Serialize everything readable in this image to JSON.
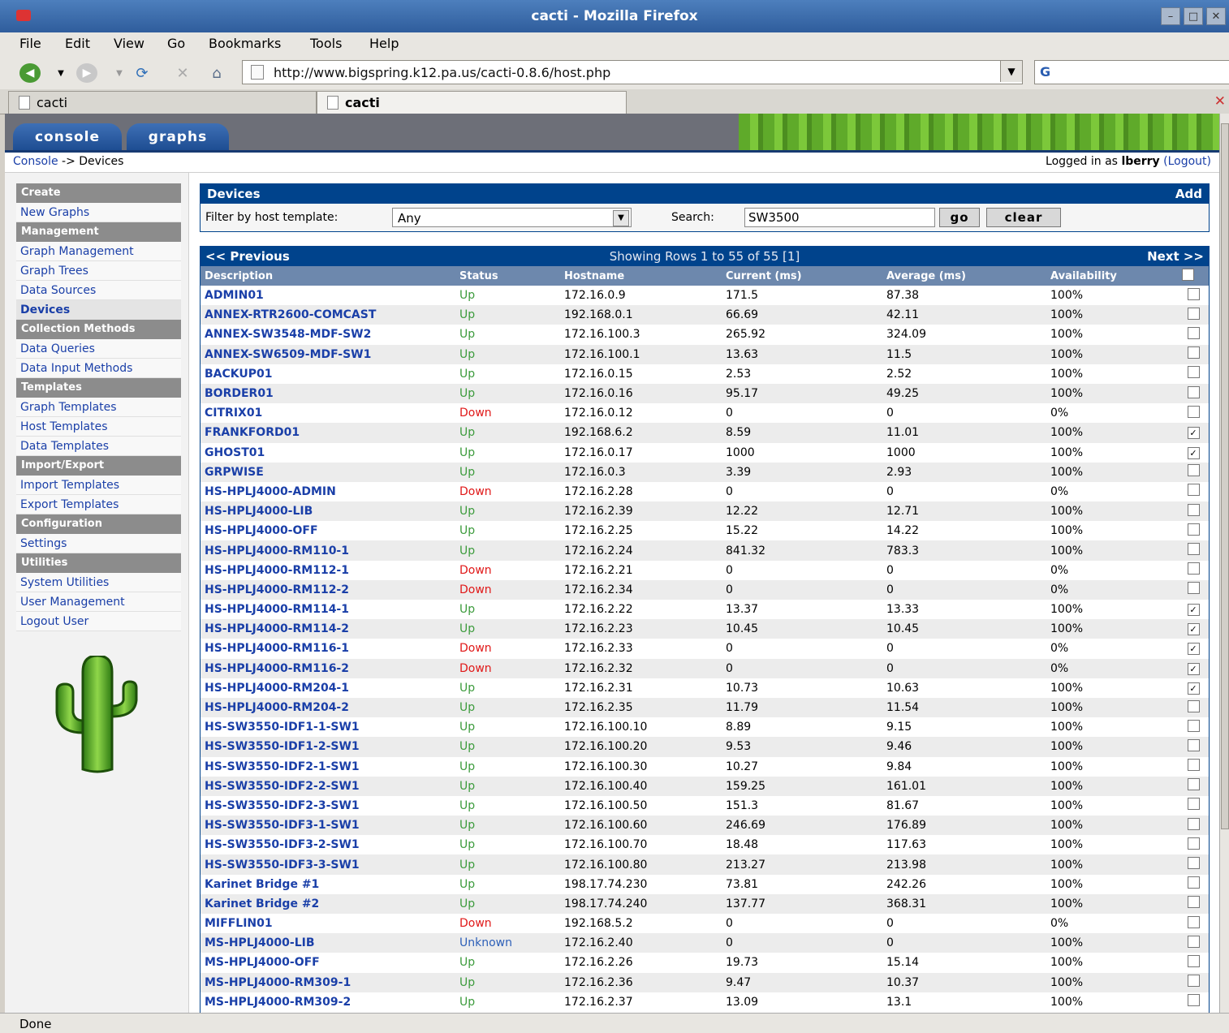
{
  "window": {
    "title": "cacti - Mozilla Firefox"
  },
  "menu": [
    "File",
    "Edit",
    "View",
    "Go",
    "Bookmarks",
    "Tools",
    "Help"
  ],
  "url": "http://www.bigspring.k12.pa.us/cacti-0.8.6/host.php",
  "tabs": [
    "cacti",
    "cacti"
  ],
  "nav": {
    "console": "console",
    "graphs": "graphs"
  },
  "breadcrumb": {
    "console": "Console",
    "rest": " -> Devices"
  },
  "login": {
    "prefix": "Logged in as ",
    "user": "lberry",
    "logout": "(Logout)"
  },
  "sidebar": [
    {
      "type": "hdr",
      "label": "Create"
    },
    {
      "type": "item",
      "label": "New Graphs"
    },
    {
      "type": "hdr",
      "label": "Management"
    },
    {
      "type": "item",
      "label": "Graph Management"
    },
    {
      "type": "item",
      "label": "Graph Trees"
    },
    {
      "type": "item",
      "label": "Data Sources"
    },
    {
      "type": "item",
      "label": "Devices",
      "selected": true
    },
    {
      "type": "hdr",
      "label": "Collection Methods"
    },
    {
      "type": "item",
      "label": "Data Queries"
    },
    {
      "type": "item",
      "label": "Data Input Methods"
    },
    {
      "type": "hdr",
      "label": "Templates"
    },
    {
      "type": "item",
      "label": "Graph Templates"
    },
    {
      "type": "item",
      "label": "Host Templates"
    },
    {
      "type": "item",
      "label": "Data Templates"
    },
    {
      "type": "hdr",
      "label": "Import/Export"
    },
    {
      "type": "item",
      "label": "Import Templates"
    },
    {
      "type": "item",
      "label": "Export Templates"
    },
    {
      "type": "hdr",
      "label": "Configuration"
    },
    {
      "type": "item",
      "label": "Settings"
    },
    {
      "type": "hdr",
      "label": "Utilities"
    },
    {
      "type": "item",
      "label": "System Utilities"
    },
    {
      "type": "item",
      "label": "User Management"
    },
    {
      "type": "item",
      "label": "Logout User"
    }
  ],
  "devices_box": {
    "title": "Devices",
    "add": "Add",
    "filter_label": "Filter by host template:",
    "filter_value": "Any",
    "search_label": "Search:",
    "search_value": "SW3500",
    "go": "go",
    "clear": "clear"
  },
  "pager": {
    "prev": "<< Previous",
    "showing": "Showing Rows 1 to 55 of 55 [1]",
    "next": "Next >>"
  },
  "columns": [
    "Description",
    "Status",
    "Hostname",
    "Current (ms)",
    "Average (ms)",
    "Availability"
  ],
  "rows": [
    {
      "d": "ADMIN01",
      "s": "Up",
      "h": "172.16.0.9",
      "c": "171.5",
      "a": "87.38",
      "v": "100%",
      "k": false
    },
    {
      "d": "ANNEX-RTR2600-COMCAST",
      "s": "Up",
      "h": "192.168.0.1",
      "c": "66.69",
      "a": "42.11",
      "v": "100%",
      "k": false
    },
    {
      "d": "ANNEX-SW3548-MDF-SW2",
      "s": "Up",
      "h": "172.16.100.3",
      "c": "265.92",
      "a": "324.09",
      "v": "100%",
      "k": false
    },
    {
      "d": "ANNEX-SW6509-MDF-SW1",
      "s": "Up",
      "h": "172.16.100.1",
      "c": "13.63",
      "a": "11.5",
      "v": "100%",
      "k": false
    },
    {
      "d": "BACKUP01",
      "s": "Up",
      "h": "172.16.0.15",
      "c": "2.53",
      "a": "2.52",
      "v": "100%",
      "k": false
    },
    {
      "d": "BORDER01",
      "s": "Up",
      "h": "172.16.0.16",
      "c": "95.17",
      "a": "49.25",
      "v": "100%",
      "k": false
    },
    {
      "d": "CITRIX01",
      "s": "Down",
      "h": "172.16.0.12",
      "c": "0",
      "a": "0",
      "v": "0%",
      "k": false
    },
    {
      "d": "FRANKFORD01",
      "s": "Up",
      "h": "192.168.6.2",
      "c": "8.59",
      "a": "11.01",
      "v": "100%",
      "k": true
    },
    {
      "d": "GHOST01",
      "s": "Up",
      "h": "172.16.0.17",
      "c": "1000",
      "a": "1000",
      "v": "100%",
      "k": true
    },
    {
      "d": "GRPWISE",
      "s": "Up",
      "h": "172.16.0.3",
      "c": "3.39",
      "a": "2.93",
      "v": "100%",
      "k": false
    },
    {
      "d": "HS-HPLJ4000-ADMIN",
      "s": "Down",
      "h": "172.16.2.28",
      "c": "0",
      "a": "0",
      "v": "0%",
      "k": false
    },
    {
      "d": "HS-HPLJ4000-LIB",
      "s": "Up",
      "h": "172.16.2.39",
      "c": "12.22",
      "a": "12.71",
      "v": "100%",
      "k": false
    },
    {
      "d": "HS-HPLJ4000-OFF",
      "s": "Up",
      "h": "172.16.2.25",
      "c": "15.22",
      "a": "14.22",
      "v": "100%",
      "k": false
    },
    {
      "d": "HS-HPLJ4000-RM110-1",
      "s": "Up",
      "h": "172.16.2.24",
      "c": "841.32",
      "a": "783.3",
      "v": "100%",
      "k": false
    },
    {
      "d": "HS-HPLJ4000-RM112-1",
      "s": "Down",
      "h": "172.16.2.21",
      "c": "0",
      "a": "0",
      "v": "0%",
      "k": false
    },
    {
      "d": "HS-HPLJ4000-RM112-2",
      "s": "Down",
      "h": "172.16.2.34",
      "c": "0",
      "a": "0",
      "v": "0%",
      "k": false
    },
    {
      "d": "HS-HPLJ4000-RM114-1",
      "s": "Up",
      "h": "172.16.2.22",
      "c": "13.37",
      "a": "13.33",
      "v": "100%",
      "k": true
    },
    {
      "d": "HS-HPLJ4000-RM114-2",
      "s": "Up",
      "h": "172.16.2.23",
      "c": "10.45",
      "a": "10.45",
      "v": "100%",
      "k": true
    },
    {
      "d": "HS-HPLJ4000-RM116-1",
      "s": "Down",
      "h": "172.16.2.33",
      "c": "0",
      "a": "0",
      "v": "0%",
      "k": true
    },
    {
      "d": "HS-HPLJ4000-RM116-2",
      "s": "Down",
      "h": "172.16.2.32",
      "c": "0",
      "a": "0",
      "v": "0%",
      "k": true
    },
    {
      "d": "HS-HPLJ4000-RM204-1",
      "s": "Up",
      "h": "172.16.2.31",
      "c": "10.73",
      "a": "10.63",
      "v": "100%",
      "k": true
    },
    {
      "d": "HS-HPLJ4000-RM204-2",
      "s": "Up",
      "h": "172.16.2.35",
      "c": "11.79",
      "a": "11.54",
      "v": "100%",
      "k": false
    },
    {
      "d": "HS-SW3550-IDF1-1-SW1",
      "s": "Up",
      "h": "172.16.100.10",
      "c": "8.89",
      "a": "9.15",
      "v": "100%",
      "k": false
    },
    {
      "d": "HS-SW3550-IDF1-2-SW1",
      "s": "Up",
      "h": "172.16.100.20",
      "c": "9.53",
      "a": "9.46",
      "v": "100%",
      "k": false
    },
    {
      "d": "HS-SW3550-IDF2-1-SW1",
      "s": "Up",
      "h": "172.16.100.30",
      "c": "10.27",
      "a": "9.84",
      "v": "100%",
      "k": false
    },
    {
      "d": "HS-SW3550-IDF2-2-SW1",
      "s": "Up",
      "h": "172.16.100.40",
      "c": "159.25",
      "a": "161.01",
      "v": "100%",
      "k": false
    },
    {
      "d": "HS-SW3550-IDF2-3-SW1",
      "s": "Up",
      "h": "172.16.100.50",
      "c": "151.3",
      "a": "81.67",
      "v": "100%",
      "k": false
    },
    {
      "d": "HS-SW3550-IDF3-1-SW1",
      "s": "Up",
      "h": "172.16.100.60",
      "c": "246.69",
      "a": "176.89",
      "v": "100%",
      "k": false
    },
    {
      "d": "HS-SW3550-IDF3-2-SW1",
      "s": "Up",
      "h": "172.16.100.70",
      "c": "18.48",
      "a": "117.63",
      "v": "100%",
      "k": false
    },
    {
      "d": "HS-SW3550-IDF3-3-SW1",
      "s": "Up",
      "h": "172.16.100.80",
      "c": "213.27",
      "a": "213.98",
      "v": "100%",
      "k": false
    },
    {
      "d": "Karinet Bridge #1",
      "s": "Up",
      "h": "198.17.74.230",
      "c": "73.81",
      "a": "242.26",
      "v": "100%",
      "k": false
    },
    {
      "d": "Karinet Bridge #2",
      "s": "Up",
      "h": "198.17.74.240",
      "c": "137.77",
      "a": "368.31",
      "v": "100%",
      "k": false
    },
    {
      "d": "MIFFLIN01",
      "s": "Down",
      "h": "192.168.5.2",
      "c": "0",
      "a": "0",
      "v": "0%",
      "k": false
    },
    {
      "d": "MS-HPLJ4000-LIB",
      "s": "Unknown",
      "h": "172.16.2.40",
      "c": "0",
      "a": "0",
      "v": "100%",
      "k": false
    },
    {
      "d": "MS-HPLJ4000-OFF",
      "s": "Up",
      "h": "172.16.2.26",
      "c": "19.73",
      "a": "15.14",
      "v": "100%",
      "k": false
    },
    {
      "d": "MS-HPLJ4000-RM309-1",
      "s": "Up",
      "h": "172.16.2.36",
      "c": "9.47",
      "a": "10.37",
      "v": "100%",
      "k": false
    },
    {
      "d": "MS-HPLJ4000-RM309-2",
      "s": "Up",
      "h": "172.16.2.37",
      "c": "13.09",
      "a": "13.1",
      "v": "100%",
      "k": false
    }
  ],
  "statusbar": "Done",
  "colors": {
    "header_blue": "#00438c",
    "up": "#3c9b3c",
    "down": "#e01818",
    "unknown": "#2c5fb8"
  }
}
